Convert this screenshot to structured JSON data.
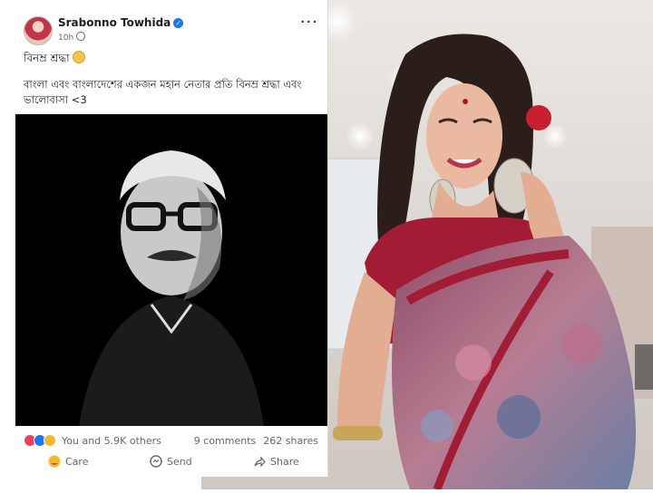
{
  "post": {
    "author": "Srabonno Towhida",
    "time": "10h",
    "title": "বিনম্র শ্রদ্ধা",
    "body": "বাংলা এবং বাংলাদেশের একজন মহান নেতার প্রতি বিনম্র শ্রদ্ধা এবং ভালোবাসা <3",
    "reactions_text": "You and 5.9K others",
    "comments": "9 comments",
    "shares": "262 shares"
  },
  "actions": {
    "care": "Care",
    "send": "Send",
    "share": "Share"
  },
  "icons": {
    "verified": "verified-badge-icon",
    "globe": "globe-icon",
    "more": "more-options-icon"
  },
  "colors": {
    "accent": "#1877f2",
    "love": "#f33e58",
    "care": "#f7b928"
  }
}
